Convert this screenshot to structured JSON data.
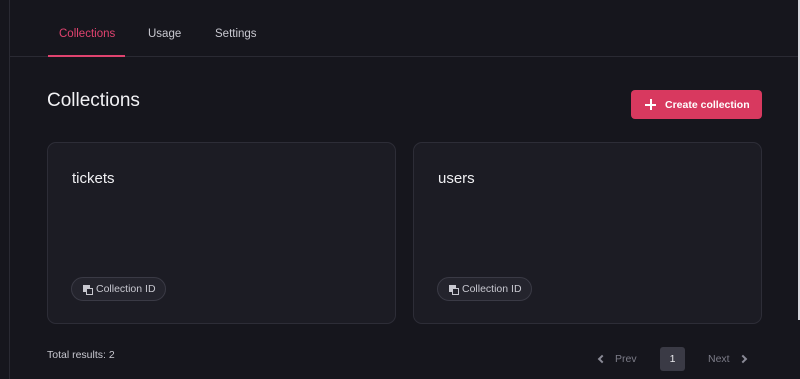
{
  "tabs": [
    {
      "label": "Collections",
      "active": true
    },
    {
      "label": "Usage",
      "active": false
    },
    {
      "label": "Settings",
      "active": false
    }
  ],
  "page_title": "Collections",
  "create_button_label": "Create collection",
  "collections": [
    {
      "name": "tickets",
      "id_label": "Collection ID"
    },
    {
      "name": "users",
      "id_label": "Collection ID"
    }
  ],
  "total_results": "Total results: 2",
  "pagination": {
    "prev_label": "Prev",
    "current_page": "1",
    "next_label": "Next"
  },
  "colors": {
    "accent": "#d8395f",
    "background": "#16161d",
    "card": "#1c1c24"
  }
}
